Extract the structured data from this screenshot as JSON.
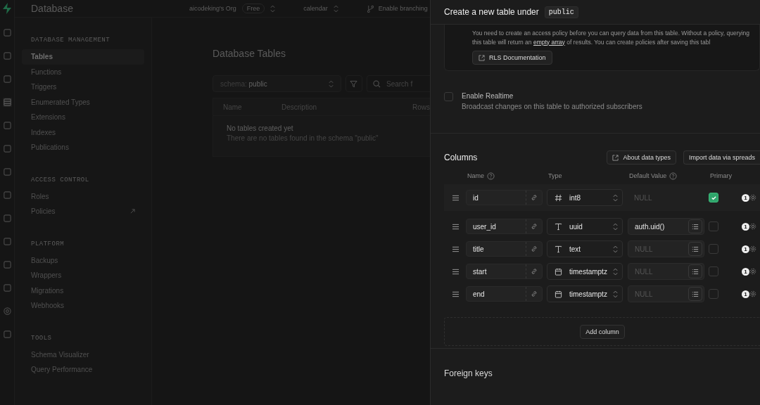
{
  "top_bar": {
    "title": "Database",
    "org": "aicodeking's Org",
    "plan": "Free",
    "project": "calendar",
    "branching": "Enable branching"
  },
  "sidebar": {
    "sections": [
      {
        "heading": "DATABASE MANAGEMENT",
        "items": [
          {
            "label": "Tables",
            "selected": true,
            "external": false
          },
          {
            "label": "Functions",
            "selected": false,
            "external": false
          },
          {
            "label": "Triggers",
            "selected": false,
            "external": false
          },
          {
            "label": "Enumerated Types",
            "selected": false,
            "external": false
          },
          {
            "label": "Extensions",
            "selected": false,
            "external": false
          },
          {
            "label": "Indexes",
            "selected": false,
            "external": false
          },
          {
            "label": "Publications",
            "selected": false,
            "external": false
          }
        ]
      },
      {
        "heading": "ACCESS CONTROL",
        "items": [
          {
            "label": "Roles",
            "selected": false,
            "external": false
          },
          {
            "label": "Policies",
            "selected": false,
            "external": true
          }
        ]
      },
      {
        "heading": "PLATFORM",
        "items": [
          {
            "label": "Backups",
            "selected": false,
            "external": false
          },
          {
            "label": "Wrappers",
            "selected": false,
            "external": false
          },
          {
            "label": "Migrations",
            "selected": false,
            "external": false
          },
          {
            "label": "Webhooks",
            "selected": false,
            "external": false
          }
        ]
      },
      {
        "heading": "TOOLS",
        "items": [
          {
            "label": "Schema Visualizer",
            "selected": false,
            "external": false
          },
          {
            "label": "Query Performance",
            "selected": false,
            "external": false
          }
        ]
      }
    ]
  },
  "main": {
    "title": "Database Tables",
    "schema_label": "schema:",
    "schema_value": "public",
    "search_placeholder": "Search f",
    "table_columns": [
      "Name",
      "Description",
      "Rows"
    ],
    "empty_title": "No tables created yet",
    "empty_text": "There are no tables found in the schema \"public\""
  },
  "panel": {
    "title": "Create a new table under",
    "schema": "public",
    "notice": {
      "before": "You need to create an access policy before you can query data from this table. Without a policy, querying this table will return an ",
      "link": "empty array",
      "after": " of results. You can create policies after saving this tabl",
      "button": "RLS Documentation"
    },
    "realtime": {
      "label": "Enable Realtime",
      "description": "Broadcast changes on this table to authorized subscribers",
      "checked": false
    },
    "columns_title": "Columns",
    "about_button": "About data types",
    "import_button": "Import data via spreads",
    "headers": [
      {
        "label": "Name",
        "help": true
      },
      {
        "label": "Type",
        "help": false
      },
      {
        "label": "Default Value",
        "help": true
      },
      {
        "label": "Primary",
        "help": false
      }
    ],
    "rows": [
      {
        "name": "id",
        "kind": "number",
        "type": "int8",
        "default": "",
        "default_placeholder": "NULL",
        "suggestions": false,
        "primary": true,
        "badge": "1"
      },
      {
        "name": "user_id",
        "kind": "text",
        "type": "uuid",
        "default": "auth.uid()",
        "suggestions": true,
        "primary": false,
        "badge": "1"
      },
      {
        "name": "title",
        "kind": "text",
        "type": "text",
        "default": "",
        "default_placeholder": "NULL",
        "suggestions": true,
        "primary": false,
        "badge": "1"
      },
      {
        "name": "start",
        "kind": "datetime",
        "type": "timestamptz",
        "default": "",
        "default_placeholder": "NULL",
        "suggestions": true,
        "primary": false,
        "badge": "1"
      },
      {
        "name": "end",
        "kind": "datetime",
        "type": "timestamptz",
        "default": "",
        "default_placeholder": "NULL",
        "suggestions": true,
        "primary": false,
        "badge": "1"
      }
    ],
    "add_column": "Add column",
    "foreign_keys": "Foreign keys"
  }
}
